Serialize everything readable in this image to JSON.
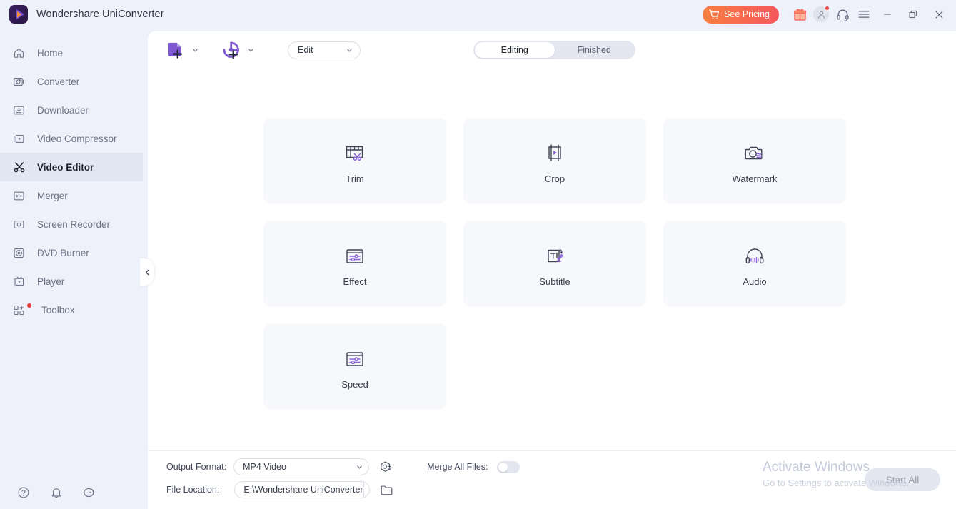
{
  "titlebar": {
    "app_title": "Wondershare UniConverter",
    "logo_icon": "uniconverter-logo-icon",
    "pricing_label": "See Pricing",
    "cart_icon": "cart-icon",
    "gift_icon": "gift-icon",
    "account_icon": "account-icon",
    "support_icon": "headset-icon",
    "menu_icon": "hamburger-menu-icon",
    "minimize_icon": "minimize-icon",
    "maximize_icon": "restore-icon",
    "close_icon": "close-icon"
  },
  "sidebar": {
    "items": [
      {
        "label": "Home",
        "icon": "home-icon",
        "active": false,
        "badge": false
      },
      {
        "label": "Converter",
        "icon": "converter-icon",
        "active": false,
        "badge": false
      },
      {
        "label": "Downloader",
        "icon": "downloader-icon",
        "active": false,
        "badge": false
      },
      {
        "label": "Video Compressor",
        "icon": "video-compressor-icon",
        "active": false,
        "badge": false
      },
      {
        "label": "Video Editor",
        "icon": "scissors-icon",
        "active": true,
        "badge": false
      },
      {
        "label": "Merger",
        "icon": "merger-icon",
        "active": false,
        "badge": false
      },
      {
        "label": "Screen Recorder",
        "icon": "screen-recorder-icon",
        "active": false,
        "badge": false
      },
      {
        "label": "DVD Burner",
        "icon": "dvd-burner-icon",
        "active": false,
        "badge": false
      },
      {
        "label": "Player",
        "icon": "player-icon",
        "active": false,
        "badge": false
      },
      {
        "label": "Toolbox",
        "icon": "toolbox-icon",
        "active": false,
        "badge": true
      }
    ],
    "bottom_icons": [
      "help-circle-icon",
      "bell-icon",
      "feedback-icon"
    ],
    "collapse_icon": "chevron-left-icon"
  },
  "toolbar": {
    "add_files_icon": "add-file-icon",
    "add_files_caret": "chevron-down-icon",
    "record_icon": "add-record-icon",
    "record_caret": "chevron-down-icon",
    "mode_select_value": "Edit",
    "mode_select_caret": "chevron-down-icon",
    "segments": [
      {
        "label": "Editing",
        "selected": true
      },
      {
        "label": "Finished",
        "selected": false
      }
    ]
  },
  "tools": [
    {
      "label": "Trim",
      "icon": "trim-icon"
    },
    {
      "label": "Crop",
      "icon": "crop-icon"
    },
    {
      "label": "Watermark",
      "icon": "watermark-icon"
    },
    {
      "label": "Effect",
      "icon": "effect-icon"
    },
    {
      "label": "Subtitle",
      "icon": "subtitle-icon"
    },
    {
      "label": "Audio",
      "icon": "audio-icon"
    },
    {
      "label": "Speed",
      "icon": "speed-icon"
    }
  ],
  "footer": {
    "output_format_label": "Output Format:",
    "output_format_value": "MP4 Video",
    "output_settings_icon": "output-settings-icon",
    "file_location_label": "File Location:",
    "file_location_value": "E:\\Wondershare UniConverter",
    "folder_icon": "folder-icon",
    "merge_label": "Merge All Files:",
    "merge_enabled": false,
    "start_all_label": "Start All"
  },
  "watermark": {
    "title": "Activate Windows",
    "subtitle": "Go to Settings to activate Windows."
  },
  "colors": {
    "accent_purple": "#7e57d1",
    "pricing_gradient_start": "#f98040",
    "pricing_gradient_end": "#f4565c",
    "sidebar_bg": "#eef1fa",
    "card_bg": "#f7f8fc",
    "active_nav_bg": "#e2e7f4",
    "badge_red": "#e23b36"
  }
}
